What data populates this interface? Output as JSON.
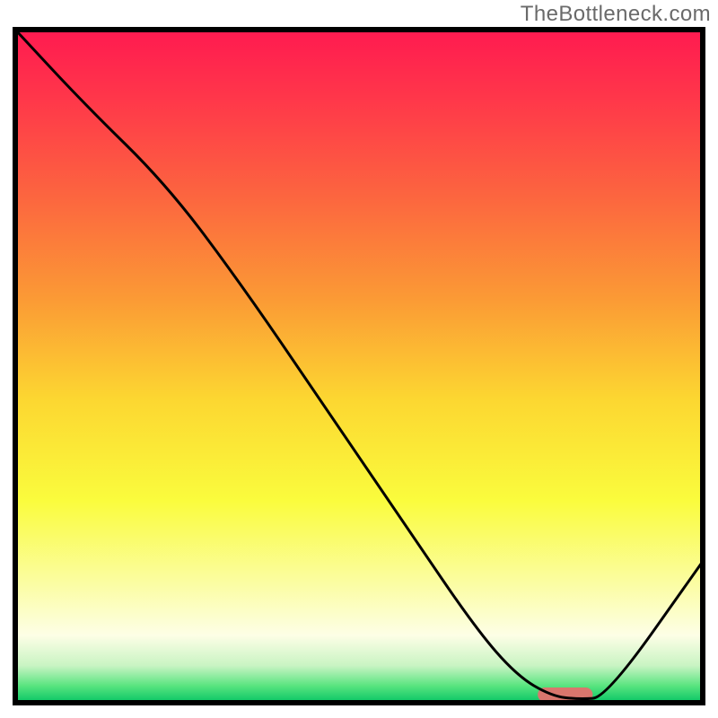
{
  "watermark": "TheBottleneck.com",
  "chart_data": {
    "type": "line",
    "title": "",
    "xlabel": "",
    "ylabel": "",
    "xlim": [
      0,
      100
    ],
    "ylim": [
      0,
      100
    ],
    "grid": false,
    "legend": false,
    "series": [
      {
        "name": "curve",
        "x": [
          0,
          10,
          22,
          33,
          45,
          57,
          67,
          73,
          78,
          82,
          86,
          100
        ],
        "y": [
          100,
          89,
          77,
          62,
          44,
          26,
          11,
          4,
          1,
          0.5,
          0.8,
          21
        ]
      }
    ],
    "marker": {
      "name": "highlight-bar",
      "x_start": 76,
      "x_end": 84,
      "y_center": 1.2,
      "color": "#d9766d"
    },
    "background_gradient": {
      "stops": [
        {
          "offset": 0.0,
          "color": "#ff1a50"
        },
        {
          "offset": 0.1,
          "color": "#ff364a"
        },
        {
          "offset": 0.25,
          "color": "#fc663f"
        },
        {
          "offset": 0.4,
          "color": "#fb9a35"
        },
        {
          "offset": 0.55,
          "color": "#fcd731"
        },
        {
          "offset": 0.7,
          "color": "#fafc3d"
        },
        {
          "offset": 0.82,
          "color": "#fbfda0"
        },
        {
          "offset": 0.9,
          "color": "#fdfee6"
        },
        {
          "offset": 0.945,
          "color": "#c9f4c3"
        },
        {
          "offset": 0.975,
          "color": "#58e47f"
        },
        {
          "offset": 1.0,
          "color": "#07c565"
        }
      ]
    },
    "border_color": "#000000"
  }
}
